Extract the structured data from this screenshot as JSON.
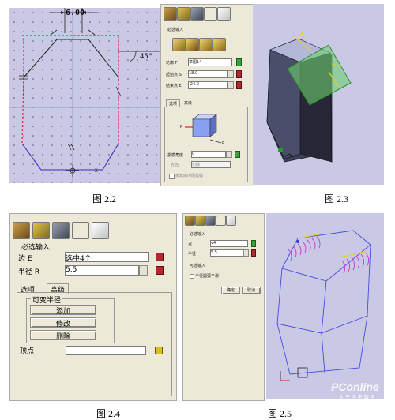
{
  "fig22": {
    "caption": "图 2.2",
    "dim_top": "6.00",
    "dim_angle": "45°",
    "mark_x": "X"
  },
  "fig23": {
    "caption": "图 2.3",
    "section_required": "必选输入",
    "profile_label": "轮廓 F",
    "profile_value": "草图14",
    "start_label": "起始点 S",
    "start_value": "18.0",
    "end_label": "结束点 E",
    "end_value": "-24.0",
    "tab_options": "选项",
    "tab_advanced": "高级",
    "draft_angle_label": "拔模角度",
    "draft_angle_value": "0",
    "direction_label": "方向",
    "direction_value": "切除",
    "checkbox_label": "按轮廓内侧拔模",
    "axis_p": "P",
    "axis_e": "E"
  },
  "fig24": {
    "caption": "图 2.4",
    "section_required": "必选输入",
    "edge_label": "边 E",
    "edge_value": "选中4个",
    "radius_label": "半径 R",
    "radius_value": "5.5",
    "tab_options": "选项",
    "tab_advanced": "高级",
    "group_variable_radius": "可变半径",
    "add_button": "添加",
    "modify_button": "修改",
    "delete_button": "删除",
    "vertex_label": "顶点"
  },
  "fig25": {
    "caption": "图 2.5",
    "section_required": "必选输入",
    "edge_label": "点",
    "edge_value": "v4",
    "radius_label": "半径",
    "radius_value": "5.5",
    "section_optional": "可选输入",
    "checkbox_label": "半径圆弧平滑",
    "ok_button": "确定",
    "cancel_button": "取消",
    "watermark_main": "PConline",
    "watermark_sub": "太 平 洋 电 脑 网"
  },
  "colors": {
    "canvas": "#c9c9e6",
    "panel": "#ece9d8",
    "profile_red": "#e0324a",
    "green": "#4caf50"
  }
}
